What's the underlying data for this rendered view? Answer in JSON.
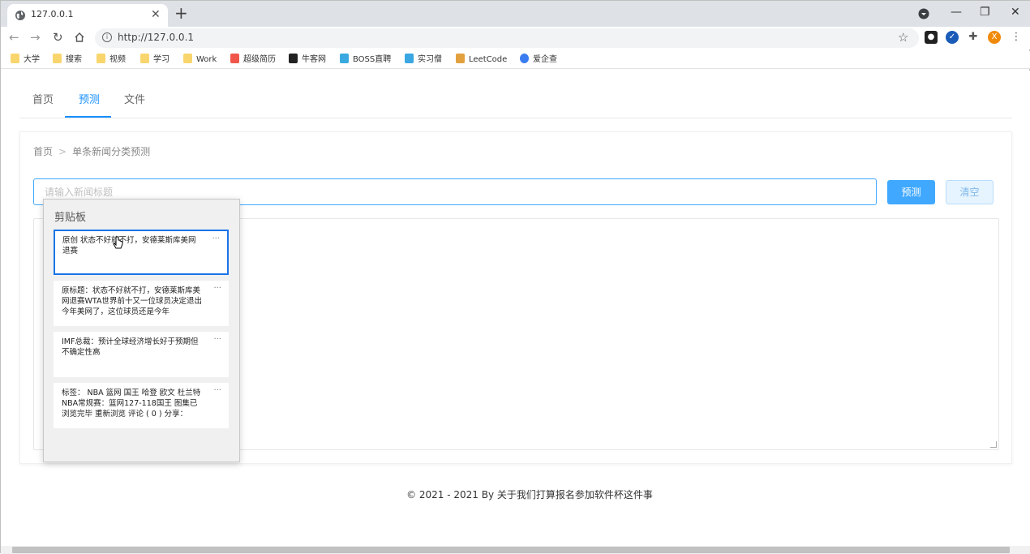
{
  "browser": {
    "tab_title": "127.0.0.1",
    "new_tab_symbol": "+",
    "url": "http://127.0.0.1",
    "profile_initial": "X"
  },
  "bookmarks": [
    {
      "label": "大学",
      "icon": "folder-icon",
      "color": "#f9d56e"
    },
    {
      "label": "搜索",
      "icon": "folder-icon",
      "color": "#f9d56e"
    },
    {
      "label": "视频",
      "icon": "folder-icon",
      "color": "#f9d56e"
    },
    {
      "label": "学习",
      "icon": "folder-icon",
      "color": "#f9d56e"
    },
    {
      "label": "Work",
      "icon": "folder-icon",
      "color": "#f9d56e"
    },
    {
      "label": "超级简历",
      "icon": "resume-icon",
      "color": "#f0574a"
    },
    {
      "label": "牛客网",
      "icon": "nowcoder-icon",
      "color": "#222222"
    },
    {
      "label": "BOSS直聘",
      "icon": "boss-icon",
      "color": "#39a9e0"
    },
    {
      "label": "实习僧",
      "icon": "shixiseng-icon",
      "color": "#3aa7e3"
    },
    {
      "label": "LeetCode",
      "icon": "leetcode-icon",
      "color": "#e2a03f"
    },
    {
      "label": "爱企查",
      "icon": "aiqicha-icon",
      "color": "#3b7df0"
    }
  ],
  "nav": {
    "tabs": [
      "首页",
      "预测",
      "文件"
    ],
    "active_index": 1
  },
  "breadcrumb": {
    "home": "首页",
    "separator": ">",
    "current": "单条新闻分类预测"
  },
  "form": {
    "title_placeholder": "请输入新闻标题",
    "predict_label": "预测",
    "clear_label": "清空"
  },
  "clipboard": {
    "title": "剪贴板",
    "more_symbol": "···",
    "items": [
      "原创 状态不好就不打，安德莱斯库美网退赛",
      "原标题：状态不好就不打，安德莱斯库美网退赛WTA世界前十又一位球员决定退出今年美网了，这位球员还是今年",
      "IMF总裁：预计全球经济增长好于预期但不确定性高",
      "标签： NBA 篮网 国王 哈登 欧文 杜兰特NBA常规赛：篮网127-118国王 图集已浏览完毕 重新浏览 评论 ( 0 ) 分享："
    ],
    "selected_index": 0
  },
  "footer": {
    "text": "© 2021 - 2021 By 关于我们打算报名参加软件杯这件事"
  },
  "colors": {
    "accent": "#1890ff",
    "primary_button": "#40a9ff",
    "clipboard_selected": "#1a73e8"
  }
}
